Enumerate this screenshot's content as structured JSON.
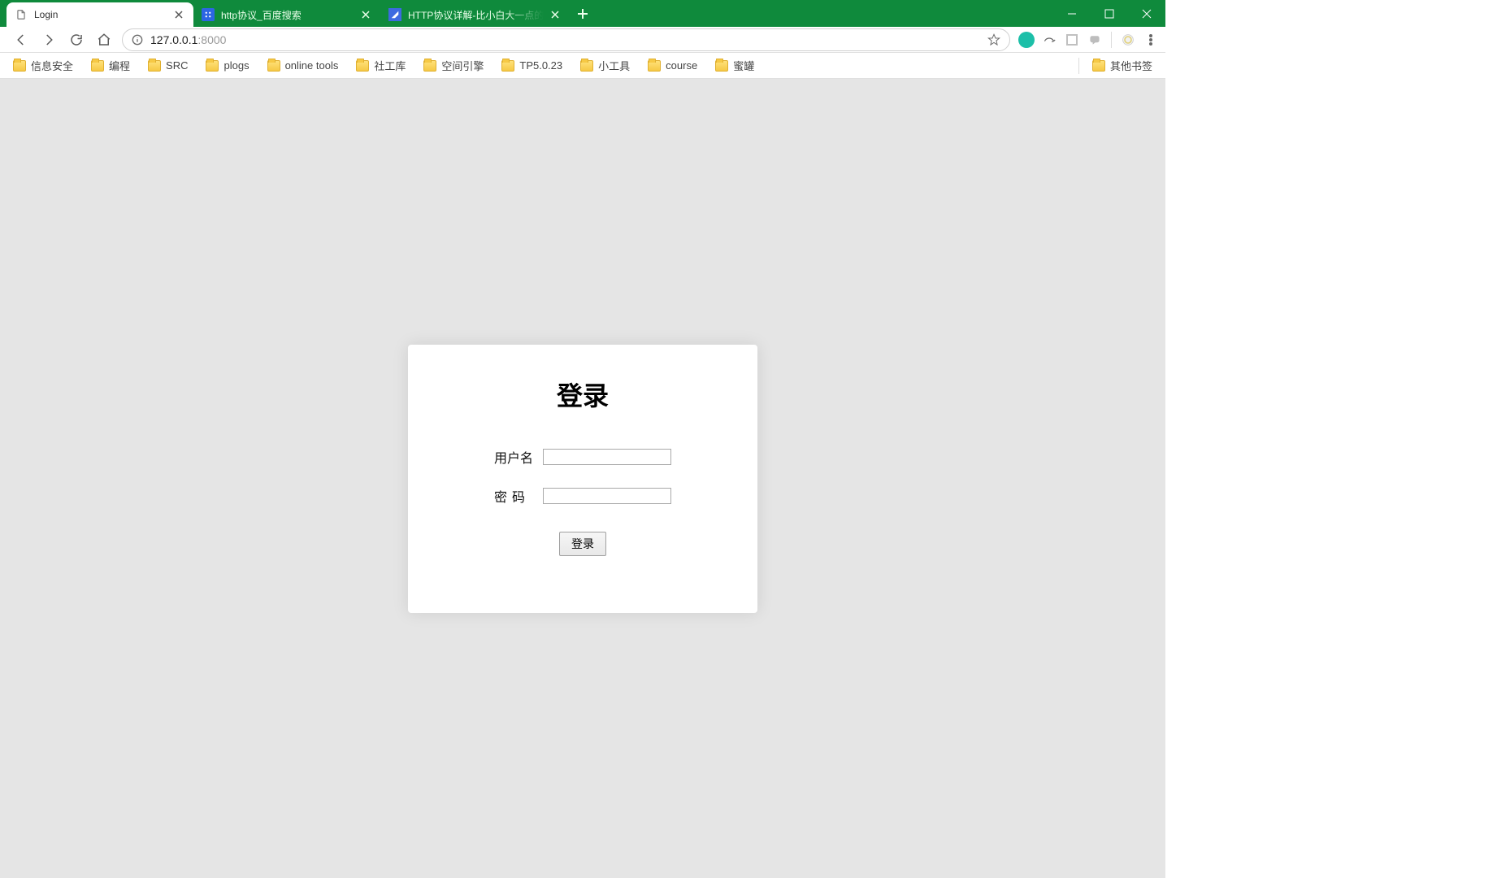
{
  "tabs": [
    {
      "title": "Login",
      "favicon_type": "page"
    },
    {
      "title": "http协议_百度搜索",
      "favicon_type": "baidu"
    },
    {
      "title": "HTTP协议详解-比小白大一点的",
      "favicon_type": "cnblogs"
    }
  ],
  "address": {
    "host": "127.0.0.1",
    "port": ":8000"
  },
  "bookmarks": {
    "items": [
      "信息安全",
      "编程",
      "SRC",
      "plogs",
      "online tools",
      "社工库",
      "空间引擎",
      "TP5.0.23",
      "小工具",
      "course",
      "蜜罐"
    ],
    "other": "其他书签"
  },
  "login": {
    "title": "登录",
    "username_label": "用户名",
    "password_label": "密码",
    "button_label": "登录"
  }
}
